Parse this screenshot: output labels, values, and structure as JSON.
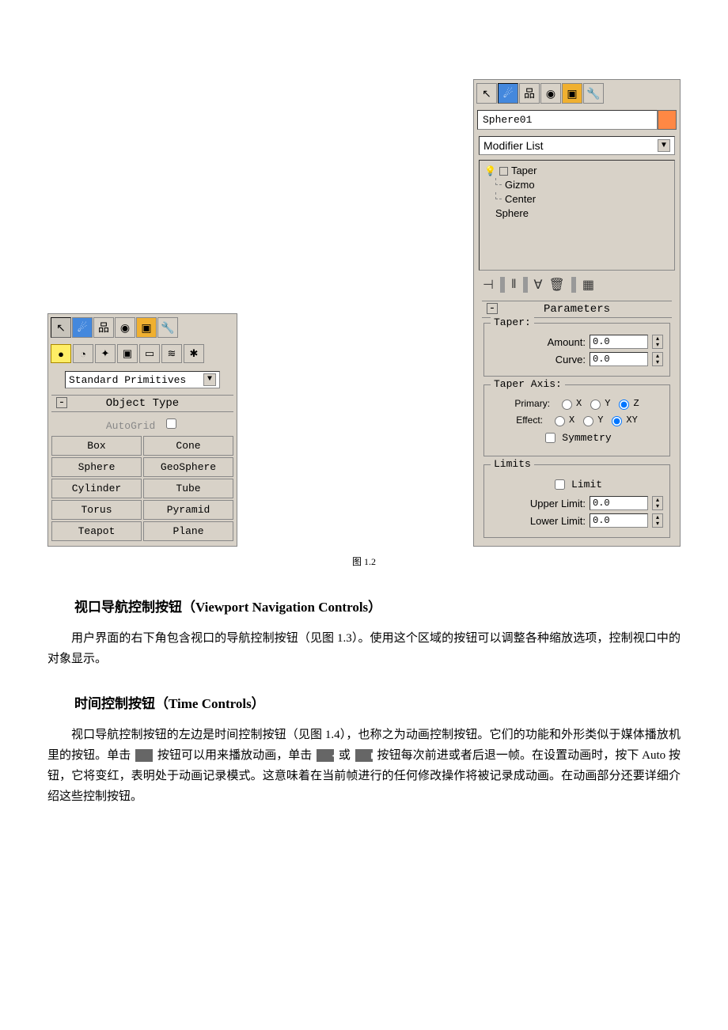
{
  "left_panel": {
    "toolbar_icons": [
      "arrow",
      "arc",
      "hierarchy",
      "motion",
      "display",
      "utilities"
    ],
    "category_icons": [
      "geometry",
      "shapes",
      "lights",
      "cameras",
      "helpers",
      "spacewarps",
      "systems"
    ],
    "dropdown": "Standard Primitives",
    "rollout_title": "Object Type",
    "autogrid_label": "AutoGrid",
    "primitives": [
      "Box",
      "Cone",
      "Sphere",
      "GeoSphere",
      "Cylinder",
      "Tube",
      "Torus",
      "Pyramid",
      "Teapot",
      "Plane"
    ]
  },
  "right_panel": {
    "toolbar_icons": [
      "arrow",
      "arc",
      "hierarchy",
      "motion",
      "display",
      "utilities"
    ],
    "object_name": "Sphere01",
    "modlist_label": "Modifier List",
    "stack": {
      "modifier": "Taper",
      "sub1": "Gizmo",
      "sub2": "Center",
      "base": "Sphere"
    },
    "params_title": "Parameters",
    "taper": {
      "group_title": "Taper:",
      "amount_label": "Amount:",
      "amount_value": "0.0",
      "curve_label": "Curve:",
      "curve_value": "0.0"
    },
    "axis": {
      "group_title": "Taper Axis:",
      "primary_label": "Primary:",
      "primary_options": [
        "X",
        "Y",
        "Z"
      ],
      "primary_selected": "Z",
      "effect_label": "Effect:",
      "effect_options": [
        "X",
        "Y",
        "XY"
      ],
      "effect_selected": "XY",
      "symmetry_label": "Symmetry"
    },
    "limits": {
      "group_title": "Limits",
      "limit_label": "Limit",
      "upper_label": "Upper Limit:",
      "upper_value": "0.0",
      "lower_label": "Lower Limit:",
      "lower_value": "0.0"
    }
  },
  "caption": "图 1.2",
  "doc": {
    "h1": "视口导航控制按钮（Viewport Navigation Controls）",
    "p1": "用户界面的右下角包含视口的导航控制按钮（见图 1.3）。使用这个区域的按钮可以调整各种缩放选项，控制视口中的对象显示。",
    "h2": "时间控制按钮（Time Controls）",
    "p2a": "视口导航控制按钮的左边是时间控制按钮（见图 1.4），也称之为动画控制按钮。它们的功能和外形类似于媒体播放机里的按钮。单击 ",
    "p2b": " 按钮可以用来播放动画，单击 ",
    "p2c": " 或 ",
    "p2d": " 按钮每次前进或者后退一帧。在设置动画时，按下 Auto 按钮，它将变红，表明处于动画记录模式。这意味着在当前帧进行的任何修改操作将被记录成动画。在动画部分还要详细介绍这些控制按钮。"
  }
}
